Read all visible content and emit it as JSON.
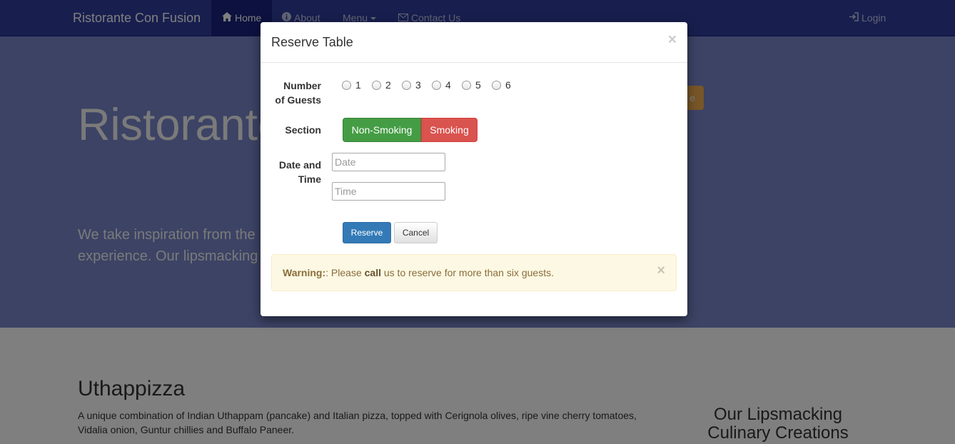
{
  "navbar": {
    "brand": "Ristorante Con Fusion",
    "items": [
      {
        "label": "Home",
        "icon": "home-icon"
      },
      {
        "label": "About",
        "icon": "info-icon"
      },
      {
        "label": "Menu",
        "icon": ""
      },
      {
        "label": "Contact Us",
        "icon": "envelope-icon"
      }
    ],
    "login": {
      "label": "Login",
      "icon": "login-icon"
    }
  },
  "jumbotron": {
    "title": "Ristorante",
    "text": "We take inspiration from the                                                         experience. Our lipsmacking",
    "button_label": "e"
  },
  "content": {
    "title": "Uthappizza",
    "description": "A unique combination of Indian Uthappam (pancake) and Italian pizza, topped with Cerignola olives, ripe vine cherry tomatoes, Vidalia onion, Guntur chillies and Buffalo Paneer.",
    "side_title": "Our Lipsmacking Culinary Creations"
  },
  "modal": {
    "title": "Reserve Table",
    "close": "×",
    "guests": {
      "label_line1": "Number",
      "label_line2": "of Guests",
      "options": [
        "1",
        "2",
        "3",
        "4",
        "5",
        "6"
      ]
    },
    "section": {
      "label": "Section",
      "non_smoking": "Non-Smoking",
      "smoking": "Smoking"
    },
    "datetime": {
      "label_line1": "Date and",
      "label_line2": "Time",
      "date_placeholder": "Date",
      "time_placeholder": "Time"
    },
    "reserve_label": "Reserve",
    "cancel_label": "Cancel",
    "alert": {
      "prefix": "Warning:",
      "text1": ": Please ",
      "strong": "call",
      "text2": " us to reserve for more than six guests.",
      "close": "×"
    }
  },
  "colors": {
    "navbar": "#303f9f",
    "jumbotron": "#7986cb",
    "success": "#449d44",
    "danger": "#d9534f",
    "primary": "#337ab7",
    "warning_bg": "#fcf8e3"
  }
}
